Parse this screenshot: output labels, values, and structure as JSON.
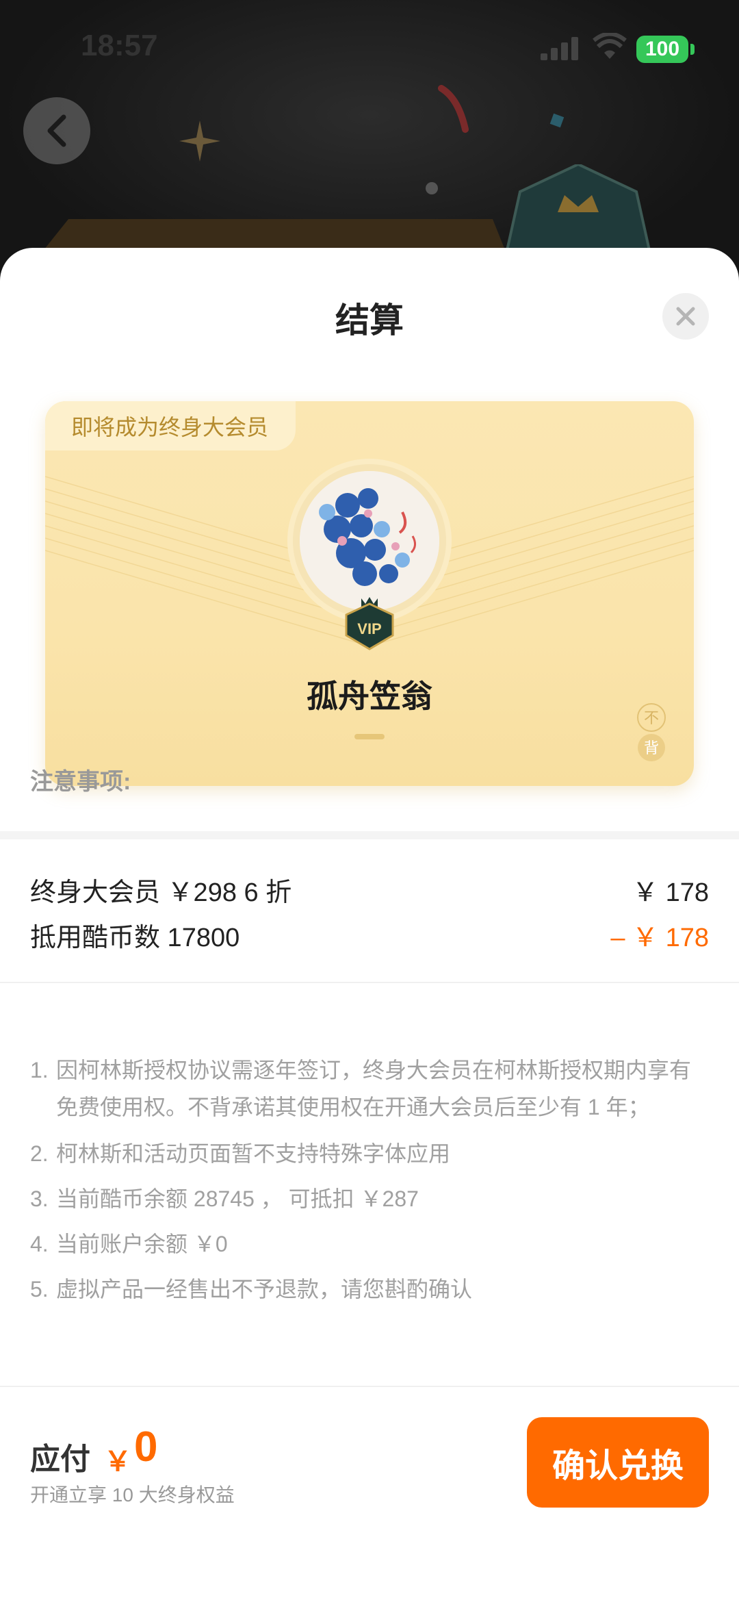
{
  "status_bar": {
    "time": "18:57",
    "battery": "100"
  },
  "sheet": {
    "title": "结算"
  },
  "card": {
    "tag": "即将成为终身大会员",
    "username": "孤舟笠翁",
    "seal_text": "不背"
  },
  "pricing": {
    "membership_label": "终身大会员 ￥298 6 折",
    "membership_price": "￥ 178",
    "coins_label": "抵用酷币数 17800",
    "coins_discount": "– ￥ 178"
  },
  "notes": {
    "title": "注意事项:",
    "items": [
      {
        "num": "1.",
        "text": "因柯林斯授权协议需逐年签订，终身大会员在柯林斯授权期内享有免费使用权。不背承诺其使用权在开通大会员后至少有 1 年；"
      },
      {
        "num": "2.",
        "text": "柯林斯和活动页面暂不支持特殊字体应用"
      },
      {
        "num": "3.",
        "text": "当前酷币余额 28745 ， 可抵扣 ￥287"
      },
      {
        "num": "4.",
        "text": "当前账户余额 ￥0"
      },
      {
        "num": "5.",
        "text": "虚拟产品一经售出不予退款，请您斟酌确认"
      }
    ]
  },
  "footer": {
    "pay_label": "应付",
    "currency": "￥",
    "amount": "0",
    "subtitle": "开通立享 10 大终身权益",
    "confirm_label": "确认兑换"
  },
  "colors": {
    "accent": "#ff6a00",
    "card_gold": "#fae4ab",
    "battery_green": "#35c759"
  }
}
